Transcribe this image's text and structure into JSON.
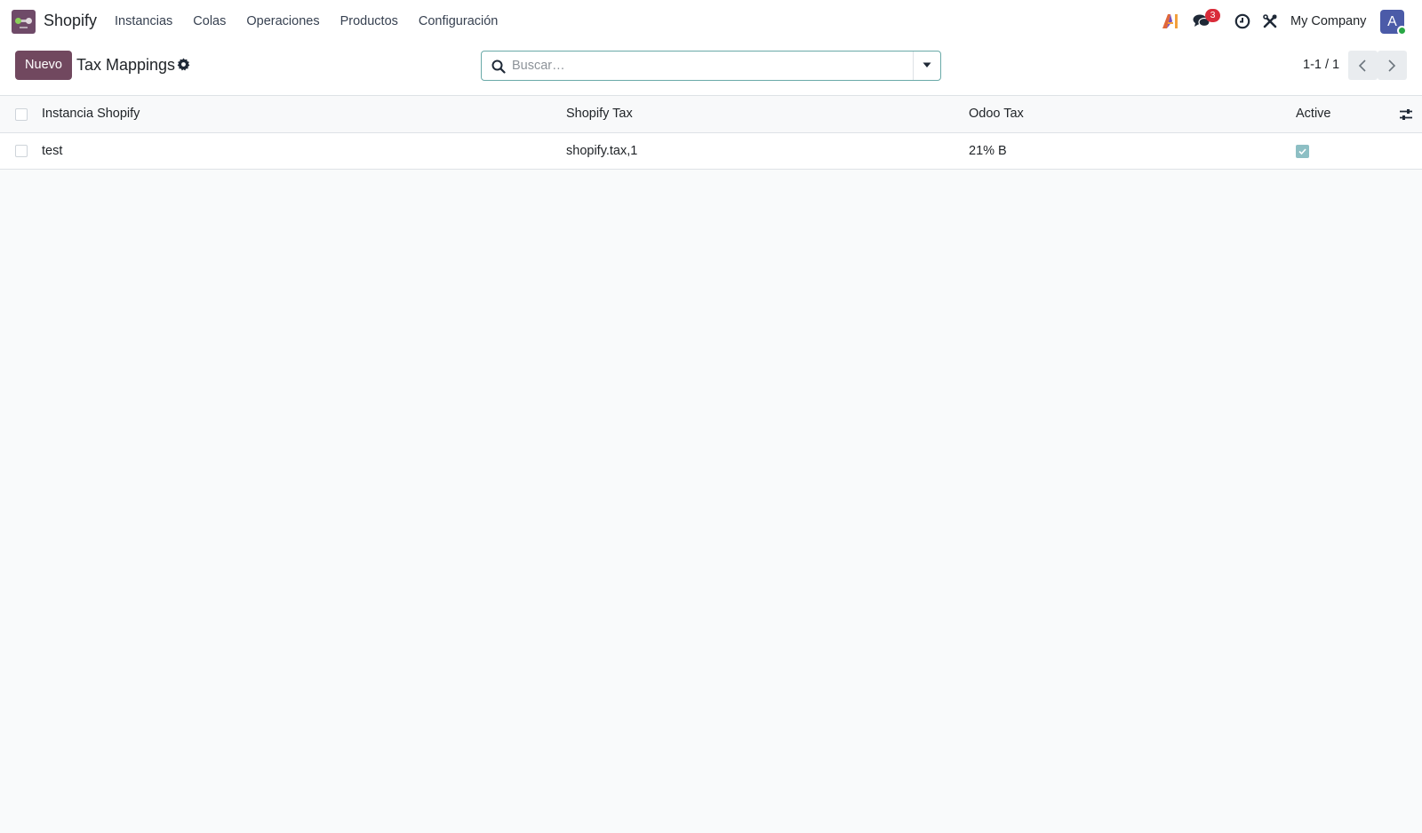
{
  "app": {
    "name": "Shopify"
  },
  "menu": {
    "items": [
      "Instancias",
      "Colas",
      "Operaciones",
      "Productos",
      "Configuración"
    ]
  },
  "systray": {
    "chat_badge": "3",
    "company": "My Company",
    "avatar_letter": "A"
  },
  "control": {
    "new_label": "Nuevo",
    "title": "Tax Mappings",
    "search_placeholder": "Buscar…",
    "pager": "1-1 / 1"
  },
  "table": {
    "headers": [
      "Instancia Shopify",
      "Shopify Tax",
      "Odoo Tax",
      "Active"
    ],
    "rows": [
      {
        "instance": "test",
        "shopify_tax": "shopify.tax,1",
        "odoo_tax": "21% B",
        "active": true
      }
    ]
  },
  "colors": {
    "brand": "#71485f",
    "accent": "#6aaaa8",
    "badge": "#d92c3a"
  }
}
